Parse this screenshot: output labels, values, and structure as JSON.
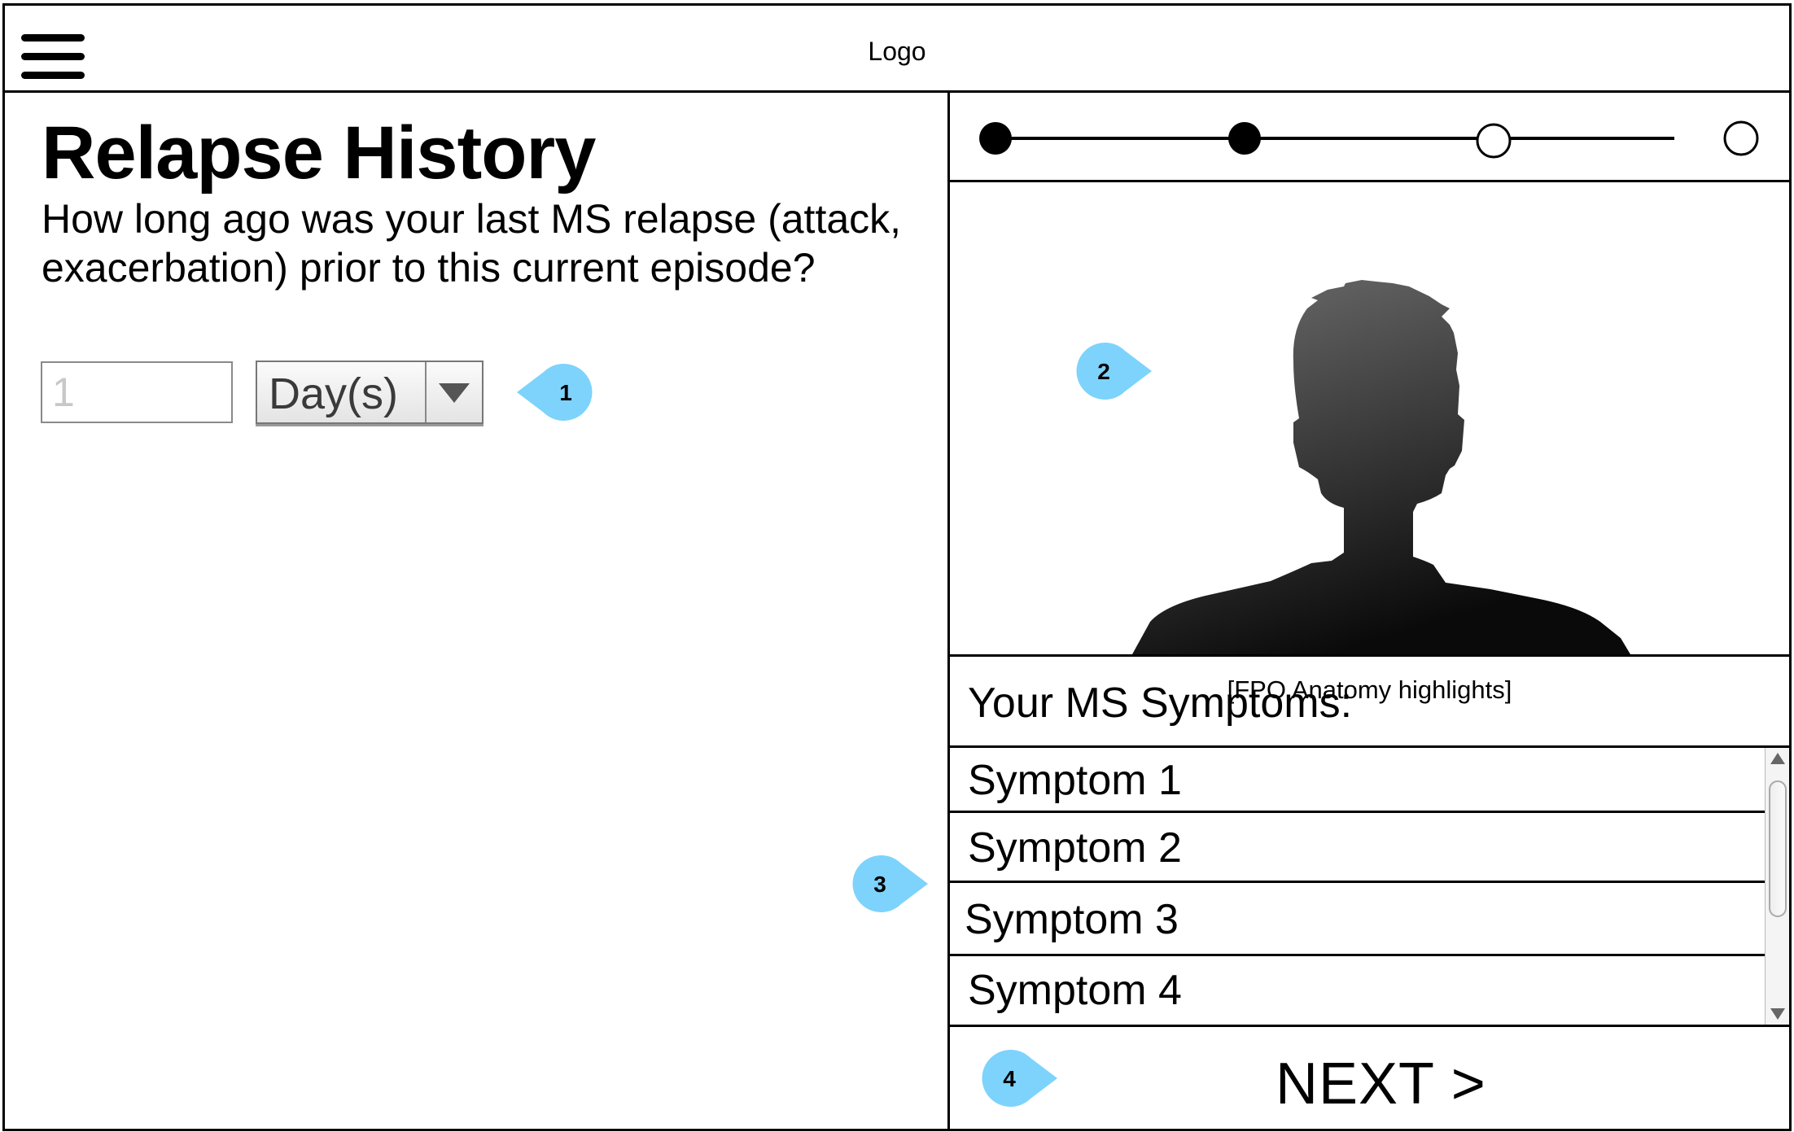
{
  "header": {
    "logo_text": "Logo",
    "menu_icon": "hamburger-menu-icon"
  },
  "main": {
    "title": "Relapse History",
    "question": "How long ago was your last MS relapse (attack, exacerbation) prior to this current episode?",
    "duration_input": {
      "value": "",
      "placeholder": "1"
    },
    "unit_select": {
      "selected": "Day(s)",
      "icon": "chevron-down-icon"
    }
  },
  "annotations": [
    "1",
    "2",
    "3",
    "4"
  ],
  "colors": {
    "callout": "#7dd3fc",
    "border": "#000000"
  },
  "progress": {
    "total_steps": 4,
    "completed_steps": 2
  },
  "figure": {
    "caption": "[FPO Anatomy highlights]",
    "icon": "person-silhouette-icon"
  },
  "symptoms": {
    "heading": "Your MS Symptoms:",
    "items": [
      "Symptom 1",
      "Symptom 2",
      "Symptom 3",
      "Symptom 4"
    ]
  },
  "next_button": {
    "label": "NEXT >"
  }
}
